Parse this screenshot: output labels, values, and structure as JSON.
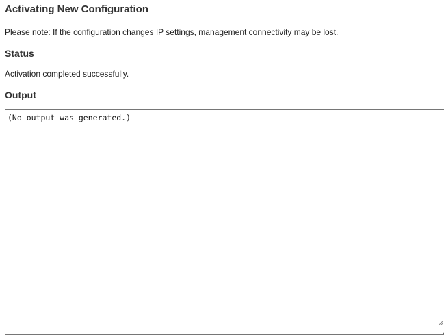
{
  "page": {
    "title": "Activating New Configuration",
    "note": "Please note: If the configuration changes IP settings, management connectivity may be lost."
  },
  "status": {
    "heading": "Status",
    "text": "Activation completed successfully."
  },
  "output": {
    "heading": "Output",
    "value": "(No output was generated.)"
  },
  "icons": {
    "resize_grip": "resize-grip-icon"
  }
}
